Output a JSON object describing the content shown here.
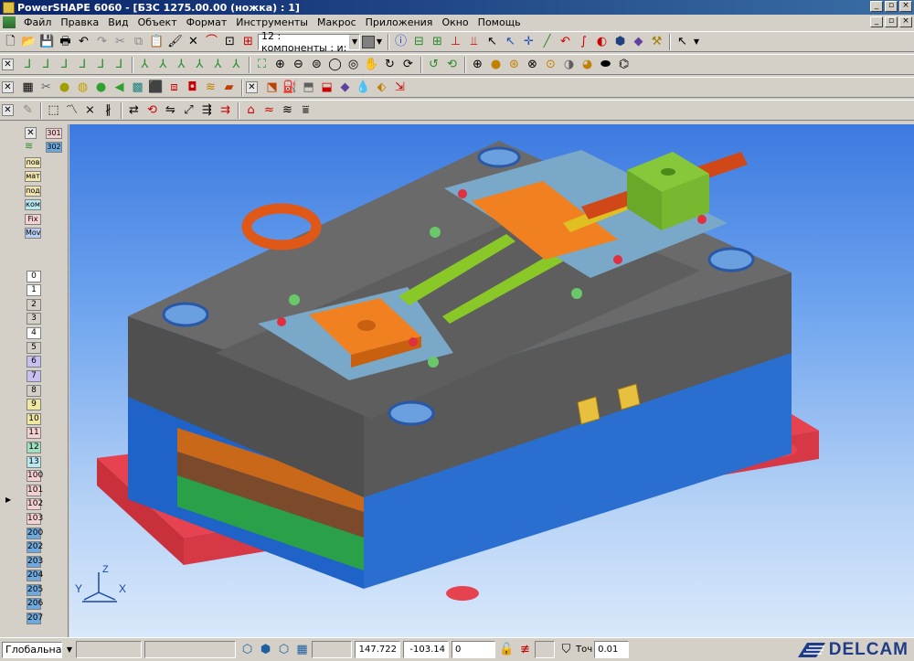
{
  "window": {
    "title": "PowerSHAPE 6060 - [БЗС 1275.00.00 (ножка) : 1]",
    "controls": [
      "_",
      "▫",
      "×"
    ]
  },
  "menu": [
    "Файл",
    "Правка",
    "Вид",
    "Объект",
    "Формат",
    "Инструменты",
    "Макрос",
    "Приложения",
    "Окно",
    "Помощь"
  ],
  "toolbar_main": {
    "component_combo": "12 : компоненты : и:",
    "color_swatch": "#808080"
  },
  "left_tags": [
    {
      "label": "301",
      "color": "#f4d0d0"
    },
    {
      "label": "302",
      "color": "#6fa8dc"
    },
    {
      "label": "пов",
      "color": "#f0e4b0"
    },
    {
      "label": "мат",
      "color": "#f0e4b0"
    },
    {
      "label": "под",
      "color": "#f0e4b0"
    },
    {
      "label": "ком",
      "color": "#b8e8f0"
    },
    {
      "label": "Fix",
      "color": "#f4d0d0"
    },
    {
      "label": "Mov",
      "color": "#b8d0f0"
    }
  ],
  "levels": [
    {
      "label": "0",
      "color": "#ffffff"
    },
    {
      "label": "1",
      "color": "#ffffff"
    },
    {
      "label": "2",
      "color": "#d4d0c8"
    },
    {
      "label": "3",
      "color": "#d4d0c8"
    },
    {
      "label": "4",
      "color": "#ffffff"
    },
    {
      "label": "5",
      "color": "#d4d0c8"
    },
    {
      "label": "6",
      "color": "#c8c0f0"
    },
    {
      "label": "7",
      "color": "#c8c0f0"
    },
    {
      "label": "8",
      "color": "#d4d0c8"
    },
    {
      "label": "9",
      "color": "#f0e8a0"
    },
    {
      "label": "10",
      "color": "#f0e8a0"
    },
    {
      "label": "11",
      "color": "#f4d0d0"
    },
    {
      "label": "12",
      "color": "#a0e0c0"
    },
    {
      "label": "13",
      "color": "#b8e8f0"
    },
    {
      "label": "100",
      "color": "#f4d0d0"
    },
    {
      "label": "101",
      "color": "#f4d0d0"
    },
    {
      "label": "102",
      "color": "#f4d0d0"
    },
    {
      "label": "103",
      "color": "#f4d0d0"
    },
    {
      "label": "200",
      "color": "#6fa8dc"
    },
    {
      "label": "202",
      "color": "#6fa8dc"
    },
    {
      "label": "203",
      "color": "#6fa8dc"
    },
    {
      "label": "204",
      "color": "#6fa8dc"
    },
    {
      "label": "205",
      "color": "#6fa8dc"
    },
    {
      "label": "206",
      "color": "#6fa8dc"
    },
    {
      "label": "207",
      "color": "#6fa8dc"
    }
  ],
  "axes": {
    "y": "Y",
    "z": "Z",
    "x": "X"
  },
  "status": {
    "workplane": "Глобальна",
    "x_coord": "147.722",
    "y_coord": "-103.14",
    "z_coord": "0",
    "tolerance_label": "Точ",
    "tolerance_value": "0.01"
  },
  "brand": "DELCAM"
}
